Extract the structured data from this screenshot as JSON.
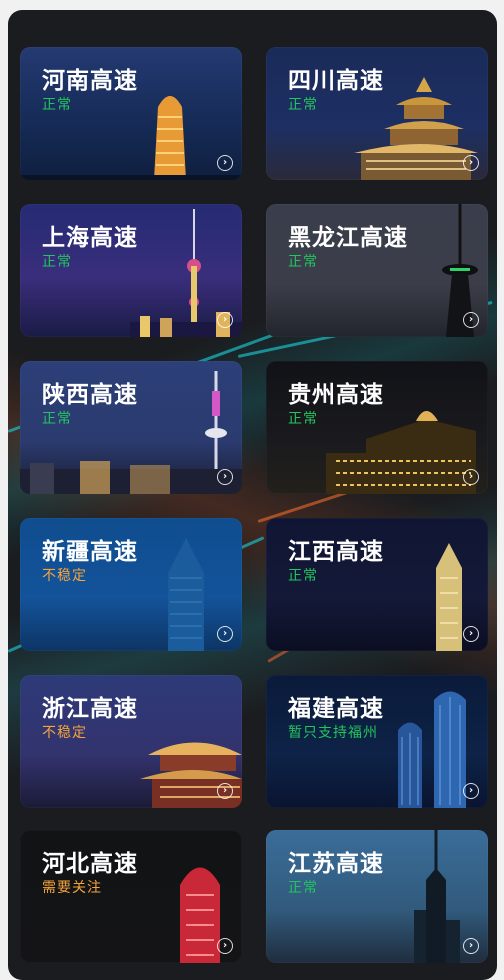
{
  "cards": [
    {
      "title": "河南高速",
      "status": "正常",
      "status_type": "ok"
    },
    {
      "title": "四川高速",
      "status": "正常",
      "status_type": "ok"
    },
    {
      "title": "上海高速",
      "status": "正常",
      "status_type": "ok"
    },
    {
      "title": "黑龙江高速",
      "status": "正常",
      "status_type": "ok"
    },
    {
      "title": "陕西高速",
      "status": "正常",
      "status_type": "ok"
    },
    {
      "title": "贵州高速",
      "status": "正常",
      "status_type": "ok"
    },
    {
      "title": "新疆高速",
      "status": "不稳定",
      "status_type": "warn"
    },
    {
      "title": "江西高速",
      "status": "正常",
      "status_type": "ok"
    },
    {
      "title": "浙江高速",
      "status": "不稳定",
      "status_type": "warn"
    },
    {
      "title": "福建高速",
      "status": "暂只支持福州",
      "status_type": "ok"
    },
    {
      "title": "河北高速",
      "status": "需要关注",
      "status_type": "warn"
    },
    {
      "title": "江苏高速",
      "status": "正常",
      "status_type": "ok"
    }
  ],
  "colors": {
    "ok": "#22c55e",
    "warn": "#f5a43c",
    "panel": "#1b1c1f"
  },
  "icons": {
    "card_arrow": "chevron-right-circle-icon"
  }
}
